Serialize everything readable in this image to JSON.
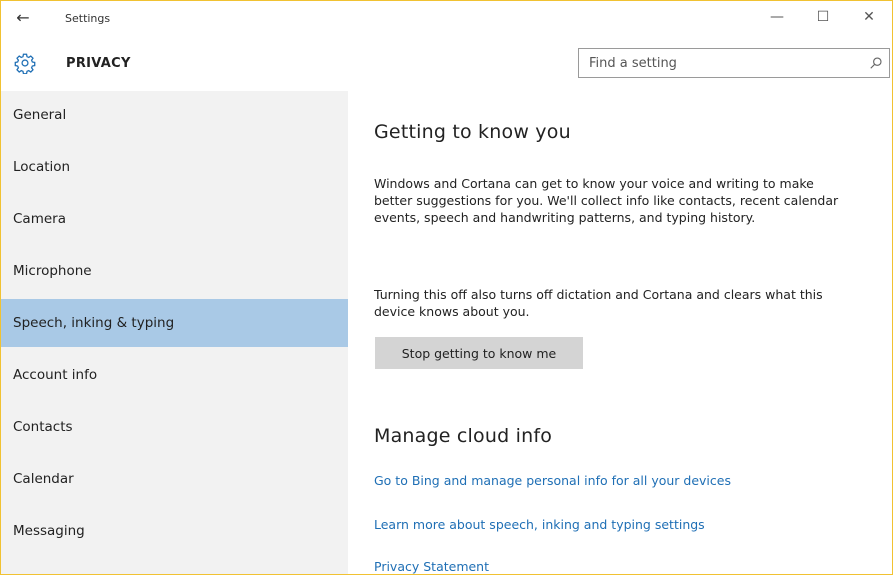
{
  "window": {
    "app_title": "Settings",
    "controls": {
      "minimize": "—",
      "maximize": "☐",
      "close": "✕"
    },
    "back_glyph": "←"
  },
  "header": {
    "page_title": "PRIVACY",
    "search_placeholder": "Find a setting"
  },
  "sidebar": {
    "items": [
      {
        "label": "General",
        "selected": false
      },
      {
        "label": "Location",
        "selected": false
      },
      {
        "label": "Camera",
        "selected": false
      },
      {
        "label": "Microphone",
        "selected": false
      },
      {
        "label": "Speech, inking & typing",
        "selected": true
      },
      {
        "label": "Account info",
        "selected": false
      },
      {
        "label": "Contacts",
        "selected": false
      },
      {
        "label": "Calendar",
        "selected": false
      },
      {
        "label": "Messaging",
        "selected": false
      }
    ]
  },
  "main": {
    "section1": {
      "heading": "Getting to know you",
      "para1": "Windows and Cortana can get to know your voice and writing to make better suggestions for you. We'll collect info like contacts, recent calendar events, speech and handwriting patterns, and typing history.",
      "para2": "Turning this off also turns off dictation and Cortana and clears what this device knows about you.",
      "button_label": "Stop getting to know me"
    },
    "section2": {
      "heading": "Manage cloud info",
      "links": [
        "Go to Bing and manage personal info for all your devices",
        "Learn more about speech, inking and typing settings",
        "Privacy Statement"
      ]
    }
  },
  "colors": {
    "selected_nav": "#a9c9e6",
    "sidebar_bg": "#f2f2f2",
    "link": "#1f6fb5",
    "button_bg": "#d4d4d4",
    "window_border": "#f1c232"
  },
  "icons": {
    "back": "back-arrow-icon",
    "header": "gear-icon",
    "search": "search-icon"
  }
}
